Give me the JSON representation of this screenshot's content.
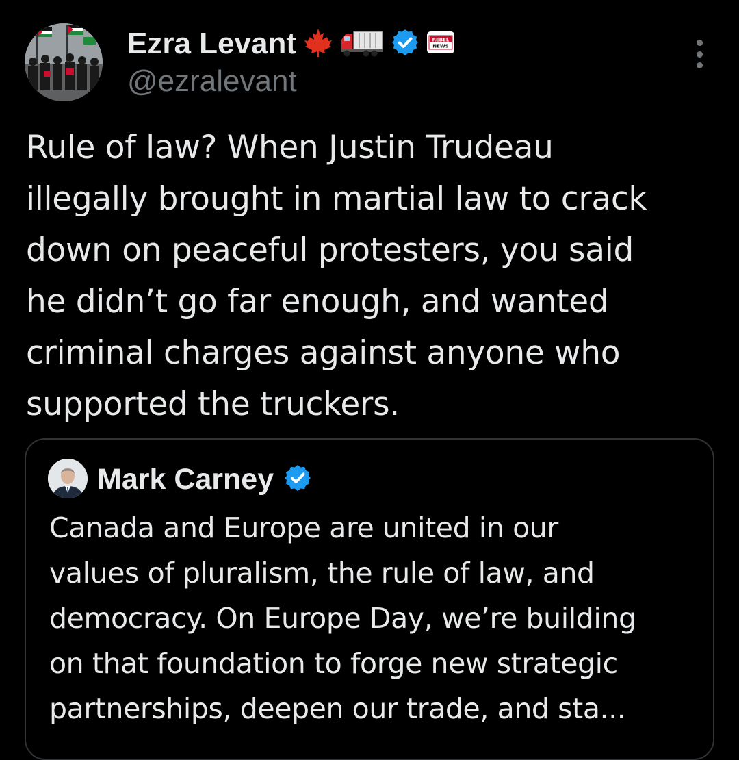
{
  "tweet": {
    "author": {
      "display_name": "Ezra Levant",
      "handle": "@ezralevant",
      "emoji_badges": [
        "🍁",
        "🚛"
      ],
      "verified": true,
      "affiliate_badge_text": [
        "REBEL",
        "NEWS"
      ]
    },
    "text_lines": [
      "Rule of law? When Justin Trudeau",
      "illegally brought in martial law to crack",
      "down on peaceful protesters, you said",
      "he didn’t go far enough, and wanted",
      "criminal charges against anyone who",
      "supported the truckers."
    ]
  },
  "quoted_tweet": {
    "author": {
      "display_name": "Mark Carney",
      "verified": true
    },
    "text_lines": [
      "Canada and Europe are united in our",
      "values of pluralism, the rule of law, and",
      "democracy. On Europe Day, we’re building",
      "on that foundation to forge new strategic",
      "partnerships, deepen our trade, and sta..."
    ]
  },
  "colors": {
    "background": "#000000",
    "text_primary": "#e7e9ea",
    "text_secondary": "#71767b",
    "verified_blue": "#1d9bf0",
    "card_border": "#2f3336",
    "maple_red": "#e0301e"
  },
  "icons": {
    "more": "more-vertical-icon",
    "verified": "verified-badge-icon",
    "maple_leaf": "maple-leaf-icon",
    "truck": "truck-icon",
    "affiliate": "rebel-news-badge"
  }
}
